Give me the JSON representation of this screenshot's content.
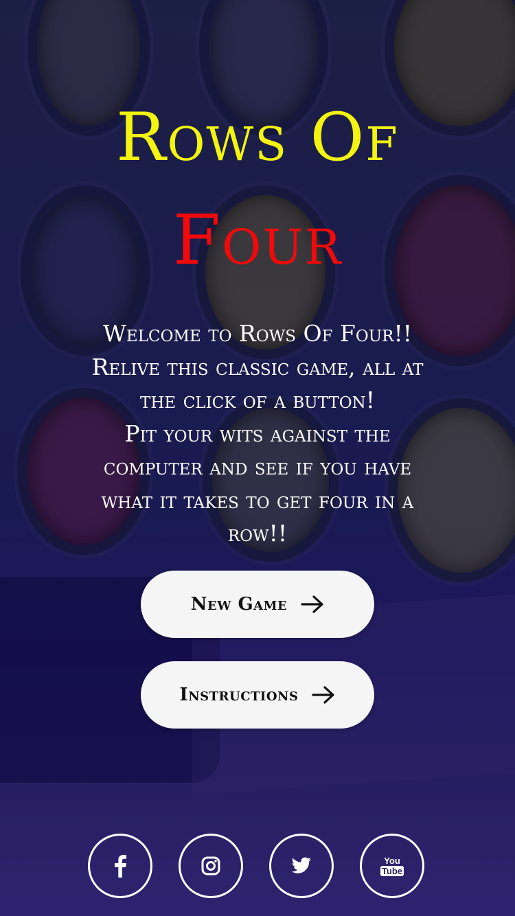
{
  "title": {
    "line1": "Rows Of",
    "line2": "Four",
    "line1_color": "#f4f411",
    "line2_color": "#f10a0a"
  },
  "intro": {
    "lines": [
      "Welcome to Rows Of Four!!",
      "Relive this classic game, all at",
      "the click of a button!",
      "Pit your wits against the",
      "computer and see if you have",
      "what it takes to get four in a",
      "row!!"
    ]
  },
  "buttons": {
    "new_game": {
      "label": "New Game",
      "icon": "arrow-right-icon"
    },
    "instructions": {
      "label": "Instructions",
      "icon": "arrow-right-icon"
    }
  },
  "social": {
    "facebook": {
      "icon": "facebook-icon"
    },
    "instagram": {
      "icon": "instagram-icon"
    },
    "twitter": {
      "icon": "twitter-icon"
    },
    "youtube": {
      "icon": "youtube-icon",
      "text_top": "You",
      "text_bottom": "Tube"
    }
  }
}
